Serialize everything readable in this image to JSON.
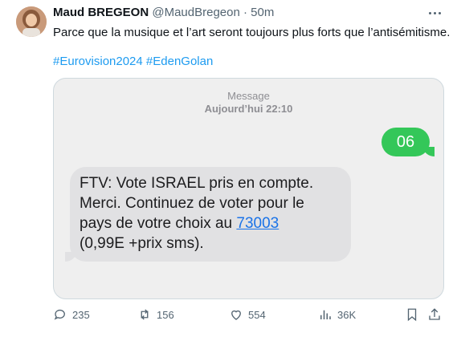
{
  "author": {
    "name": "Maud BREGEON",
    "handle": "@MaudBregeon",
    "separator": "·",
    "time": "50m"
  },
  "tweet": {
    "text": "Parce que la musique et l’art seront toujours plus forts que l’antisémitisme.",
    "hashtags": [
      "#Eurovision2024",
      "#EdenGolan"
    ]
  },
  "media": {
    "header_label": "Message",
    "header_time": "Aujourd’hui 22:10",
    "outgoing_message": "06",
    "incoming_lines": [
      "FTV: Vote ISRAEL  pris en compte.",
      "Merci. Continuez de voter pour le",
      "pays de votre choix au "
    ],
    "incoming_link": "73003",
    "incoming_last_line": "(0,99E +prix sms).",
    "colors": {
      "outgoing": "#34c759",
      "incoming": "#e1e1e3",
      "link": "#1a73e8"
    }
  },
  "actions": {
    "replies": "235",
    "retweets": "156",
    "likes": "554",
    "views": "36K",
    "icons": [
      "reply-icon",
      "retweet-icon",
      "like-icon",
      "views-icon",
      "bookmark-icon",
      "share-icon"
    ]
  }
}
